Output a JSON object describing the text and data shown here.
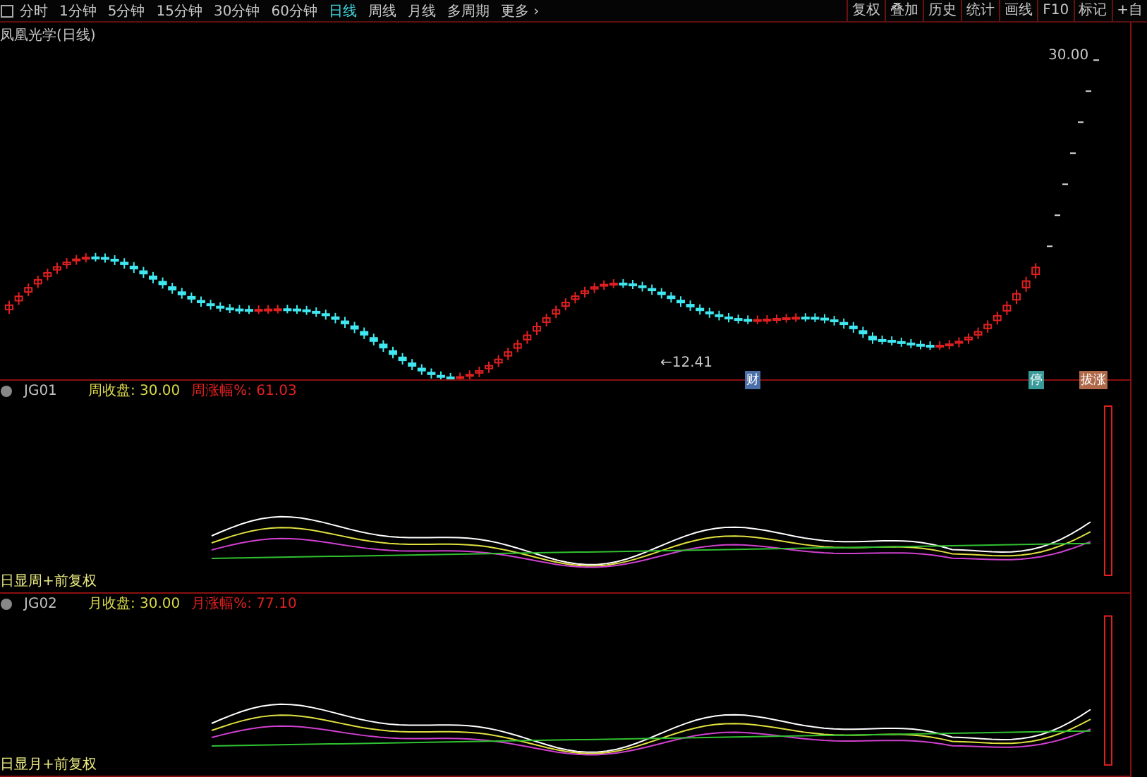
{
  "toolbar": {
    "periods": [
      {
        "label": "分时",
        "selected": false
      },
      {
        "label": "1分钟",
        "selected": false
      },
      {
        "label": "5分钟",
        "selected": false
      },
      {
        "label": "15分钟",
        "selected": false
      },
      {
        "label": "30分钟",
        "selected": false
      },
      {
        "label": "60分钟",
        "selected": false
      },
      {
        "label": "日线",
        "selected": true
      },
      {
        "label": "周线",
        "selected": false
      },
      {
        "label": "月线",
        "selected": false
      },
      {
        "label": "多周期",
        "selected": false
      },
      {
        "label": "更多 ›",
        "selected": false
      }
    ],
    "tools": [
      "复权",
      "叠加",
      "历史",
      "统计",
      "画线",
      "F10",
      "标记",
      "+自"
    ]
  },
  "main_chart": {
    "title": "凤凰光学(日线)",
    "high_label": "30.00",
    "low_label": "←12.41",
    "markers": [
      {
        "text": "财",
        "color": "#4a6fa8"
      },
      {
        "text": "停",
        "color": "#3a9a9a"
      },
      {
        "text": "拔涨",
        "color": "#b06a4a"
      }
    ]
  },
  "indicators": [
    {
      "name": "JG01",
      "legend": [
        {
          "text": "周收盘: 30.00",
          "color": "#d8d84a"
        },
        {
          "text": "周涨幅%: 61.03",
          "color": "#e02020"
        }
      ],
      "footer": "日显周+前复权"
    },
    {
      "name": "JG02",
      "legend": [
        {
          "text": "月收盘: 30.00",
          "color": "#d8d84a"
        },
        {
          "text": "月涨幅%: 77.10",
          "color": "#e02020"
        }
      ],
      "footer": "日显月+前复权"
    }
  ]
}
